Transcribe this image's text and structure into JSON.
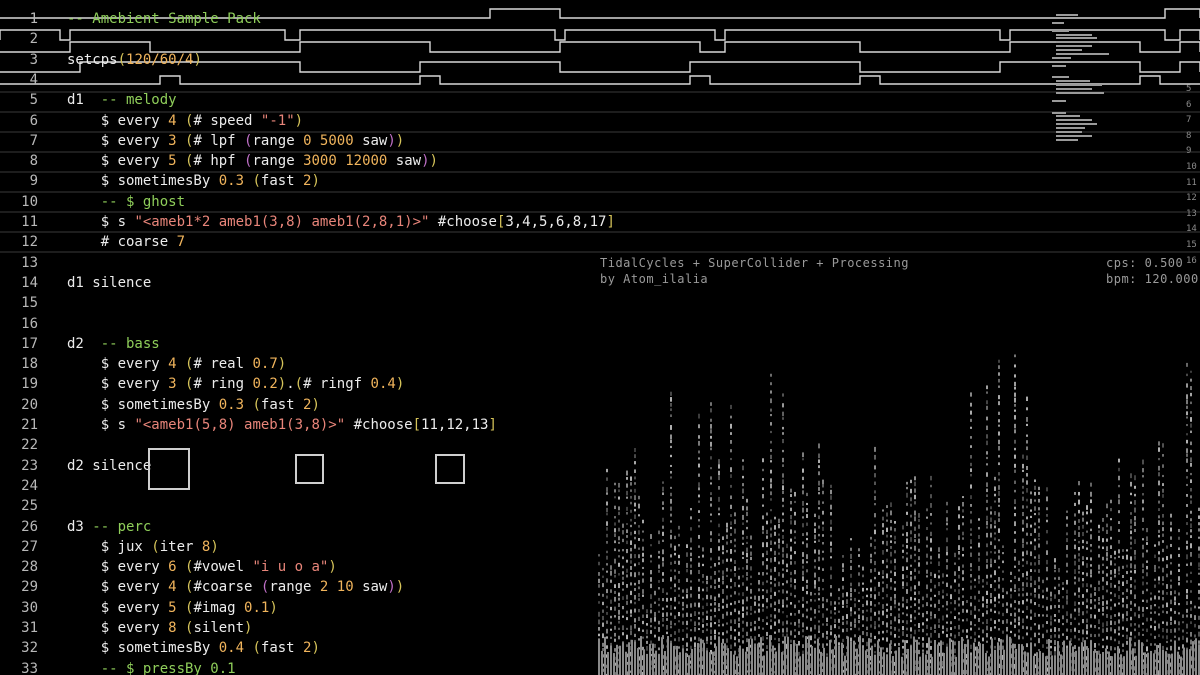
{
  "editor": {
    "lines": [
      {
        "n": "1",
        "parts": [
          {
            "t": "-- Amebient Sample Pack",
            "c": "comment"
          }
        ]
      },
      {
        "n": "2",
        "parts": []
      },
      {
        "n": "3",
        "parts": [
          {
            "t": "setcps",
            "c": "plain"
          },
          {
            "t": "(",
            "c": "paren"
          },
          {
            "t": "120/60/4",
            "c": "num"
          },
          {
            "t": ")",
            "c": "paren"
          }
        ]
      },
      {
        "n": "4",
        "parts": []
      },
      {
        "n": "5",
        "parts": [
          {
            "t": "d1  ",
            "c": "plain"
          },
          {
            "t": "-- melody",
            "c": "comment"
          }
        ]
      },
      {
        "n": "6",
        "parts": [
          {
            "t": "    $ every ",
            "c": "plain"
          },
          {
            "t": "4",
            "c": "num"
          },
          {
            "t": " ",
            "c": "plain"
          },
          {
            "t": "(",
            "c": "paren"
          },
          {
            "t": "# speed ",
            "c": "plain"
          },
          {
            "t": "\"-1\"",
            "c": "str"
          },
          {
            "t": ")",
            "c": "paren"
          }
        ]
      },
      {
        "n": "7",
        "parts": [
          {
            "t": "    $ every ",
            "c": "plain"
          },
          {
            "t": "3",
            "c": "num"
          },
          {
            "t": " ",
            "c": "plain"
          },
          {
            "t": "(",
            "c": "paren"
          },
          {
            "t": "# lpf ",
            "c": "plain"
          },
          {
            "t": "(",
            "c": "paren2"
          },
          {
            "t": "range ",
            "c": "plain"
          },
          {
            "t": "0 5000",
            "c": "num"
          },
          {
            "t": " saw",
            "c": "plain"
          },
          {
            "t": ")",
            "c": "paren2"
          },
          {
            "t": ")",
            "c": "paren"
          }
        ]
      },
      {
        "n": "8",
        "parts": [
          {
            "t": "    $ every ",
            "c": "plain"
          },
          {
            "t": "5",
            "c": "num"
          },
          {
            "t": " ",
            "c": "plain"
          },
          {
            "t": "(",
            "c": "paren"
          },
          {
            "t": "# hpf ",
            "c": "plain"
          },
          {
            "t": "(",
            "c": "paren2"
          },
          {
            "t": "range ",
            "c": "plain"
          },
          {
            "t": "3000 12000",
            "c": "num"
          },
          {
            "t": " saw",
            "c": "plain"
          },
          {
            "t": ")",
            "c": "paren2"
          },
          {
            "t": ")",
            "c": "paren"
          }
        ]
      },
      {
        "n": "9",
        "parts": [
          {
            "t": "    $ sometimesBy ",
            "c": "plain"
          },
          {
            "t": "0.3",
            "c": "num"
          },
          {
            "t": " ",
            "c": "plain"
          },
          {
            "t": "(",
            "c": "paren"
          },
          {
            "t": "fast ",
            "c": "plain"
          },
          {
            "t": "2",
            "c": "num"
          },
          {
            "t": ")",
            "c": "paren"
          }
        ]
      },
      {
        "n": "10",
        "parts": [
          {
            "t": "    -- $ ghost",
            "c": "comment"
          }
        ]
      },
      {
        "n": "11",
        "parts": [
          {
            "t": "    $ s ",
            "c": "plain"
          },
          {
            "t": "\"<ameb1*2 ameb1(3,8) ameb1(2,8,1)>\"",
            "c": "str"
          },
          {
            "t": " #choose",
            "c": "plain"
          },
          {
            "t": "[",
            "c": "paren"
          },
          {
            "t": "3,4,5,6,8,17",
            "c": "plain"
          },
          {
            "t": "]",
            "c": "paren"
          }
        ]
      },
      {
        "n": "12",
        "parts": [
          {
            "t": "    # coarse ",
            "c": "plain"
          },
          {
            "t": "7",
            "c": "num"
          }
        ]
      },
      {
        "n": "13",
        "parts": []
      },
      {
        "n": "14",
        "parts": [
          {
            "t": "d1 silence",
            "c": "plain"
          }
        ]
      },
      {
        "n": "15",
        "parts": []
      },
      {
        "n": "16",
        "parts": []
      },
      {
        "n": "17",
        "parts": [
          {
            "t": "d2  ",
            "c": "plain"
          },
          {
            "t": "-- bass",
            "c": "comment"
          }
        ]
      },
      {
        "n": "18",
        "parts": [
          {
            "t": "    $ every ",
            "c": "plain"
          },
          {
            "t": "4",
            "c": "num"
          },
          {
            "t": " ",
            "c": "plain"
          },
          {
            "t": "(",
            "c": "paren"
          },
          {
            "t": "# real ",
            "c": "plain"
          },
          {
            "t": "0.7",
            "c": "num"
          },
          {
            "t": ")",
            "c": "paren"
          }
        ]
      },
      {
        "n": "19",
        "parts": [
          {
            "t": "    $ every ",
            "c": "plain"
          },
          {
            "t": "3",
            "c": "num"
          },
          {
            "t": " ",
            "c": "plain"
          },
          {
            "t": "(",
            "c": "paren"
          },
          {
            "t": "# ring ",
            "c": "plain"
          },
          {
            "t": "0.2",
            "c": "num"
          },
          {
            "t": ")",
            "c": "paren"
          },
          {
            "t": ".",
            "c": "plain"
          },
          {
            "t": "(",
            "c": "paren"
          },
          {
            "t": "# ringf ",
            "c": "plain"
          },
          {
            "t": "0.4",
            "c": "num"
          },
          {
            "t": ")",
            "c": "paren"
          }
        ]
      },
      {
        "n": "20",
        "parts": [
          {
            "t": "    $ sometimesBy ",
            "c": "plain"
          },
          {
            "t": "0.3",
            "c": "num"
          },
          {
            "t": " ",
            "c": "plain"
          },
          {
            "t": "(",
            "c": "paren"
          },
          {
            "t": "fast ",
            "c": "plain"
          },
          {
            "t": "2",
            "c": "num"
          },
          {
            "t": ")",
            "c": "paren"
          }
        ]
      },
      {
        "n": "21",
        "parts": [
          {
            "t": "    $ s ",
            "c": "plain"
          },
          {
            "t": "\"<ameb1(5,8) ameb1(3,8)>\"",
            "c": "str"
          },
          {
            "t": " #choose",
            "c": "plain"
          },
          {
            "t": "[",
            "c": "paren"
          },
          {
            "t": "11,12,13",
            "c": "plain"
          },
          {
            "t": "]",
            "c": "paren"
          }
        ]
      },
      {
        "n": "22",
        "parts": []
      },
      {
        "n": "23",
        "parts": [
          {
            "t": "d2 silence",
            "c": "plain"
          }
        ]
      },
      {
        "n": "24",
        "parts": []
      },
      {
        "n": "25",
        "parts": []
      },
      {
        "n": "26",
        "parts": [
          {
            "t": "d3 ",
            "c": "plain"
          },
          {
            "t": "-- perc",
            "c": "comment"
          }
        ]
      },
      {
        "n": "27",
        "parts": [
          {
            "t": "    $ jux ",
            "c": "plain"
          },
          {
            "t": "(",
            "c": "paren"
          },
          {
            "t": "iter ",
            "c": "plain"
          },
          {
            "t": "8",
            "c": "num"
          },
          {
            "t": ")",
            "c": "paren"
          }
        ]
      },
      {
        "n": "28",
        "parts": [
          {
            "t": "    $ every ",
            "c": "plain"
          },
          {
            "t": "6",
            "c": "num"
          },
          {
            "t": " ",
            "c": "plain"
          },
          {
            "t": "(",
            "c": "paren"
          },
          {
            "t": "#vowel ",
            "c": "plain"
          },
          {
            "t": "\"i u o a\"",
            "c": "str"
          },
          {
            "t": ")",
            "c": "paren"
          }
        ]
      },
      {
        "n": "29",
        "parts": [
          {
            "t": "    $ every ",
            "c": "plain"
          },
          {
            "t": "4",
            "c": "num"
          },
          {
            "t": " ",
            "c": "plain"
          },
          {
            "t": "(",
            "c": "paren"
          },
          {
            "t": "#coarse ",
            "c": "plain"
          },
          {
            "t": "(",
            "c": "paren2"
          },
          {
            "t": "range ",
            "c": "plain"
          },
          {
            "t": "2 10",
            "c": "num"
          },
          {
            "t": " saw",
            "c": "plain"
          },
          {
            "t": ")",
            "c": "paren2"
          },
          {
            "t": ")",
            "c": "paren"
          }
        ]
      },
      {
        "n": "30",
        "parts": [
          {
            "t": "    $ every ",
            "c": "plain"
          },
          {
            "t": "5",
            "c": "num"
          },
          {
            "t": " ",
            "c": "plain"
          },
          {
            "t": "(",
            "c": "paren"
          },
          {
            "t": "#imag ",
            "c": "plain"
          },
          {
            "t": "0.1",
            "c": "num"
          },
          {
            "t": ")",
            "c": "paren"
          }
        ]
      },
      {
        "n": "31",
        "parts": [
          {
            "t": "    $ every ",
            "c": "plain"
          },
          {
            "t": "8",
            "c": "num"
          },
          {
            "t": " ",
            "c": "plain"
          },
          {
            "t": "(",
            "c": "paren"
          },
          {
            "t": "silent",
            "c": "plain"
          },
          {
            "t": ")",
            "c": "paren"
          }
        ]
      },
      {
        "n": "32",
        "parts": [
          {
            "t": "    $ sometimesBy ",
            "c": "plain"
          },
          {
            "t": "0.4",
            "c": "num"
          },
          {
            "t": " ",
            "c": "plain"
          },
          {
            "t": "(",
            "c": "paren"
          },
          {
            "t": "fast ",
            "c": "plain"
          },
          {
            "t": "2",
            "c": "num"
          },
          {
            "t": ")",
            "c": "paren"
          }
        ]
      },
      {
        "n": "33",
        "parts": [
          {
            "t": "    -- $ pressBy 0.1",
            "c": "comment"
          }
        ]
      }
    ]
  },
  "hud": {
    "title": "TidalCycles + SuperCollider + Processing",
    "byline": "by Atom_ilalia",
    "cps": "cps: 0.500",
    "bpm": "bpm: 120.000"
  },
  "right_gutter": [
    "5",
    "6",
    "7",
    "8",
    "9",
    "10",
    "11",
    "12",
    "13",
    "14",
    "15",
    "16"
  ],
  "colors": {
    "comment": "#8fce5a",
    "num": "#f0b45c",
    "str": "#e8857a",
    "paren": "#d6c45a",
    "paren2": "#c070c8",
    "plain": "#ececec",
    "background": "#000000"
  },
  "icons": [
    "square-outline-icon",
    "square-outline-icon",
    "square-outline-icon"
  ]
}
